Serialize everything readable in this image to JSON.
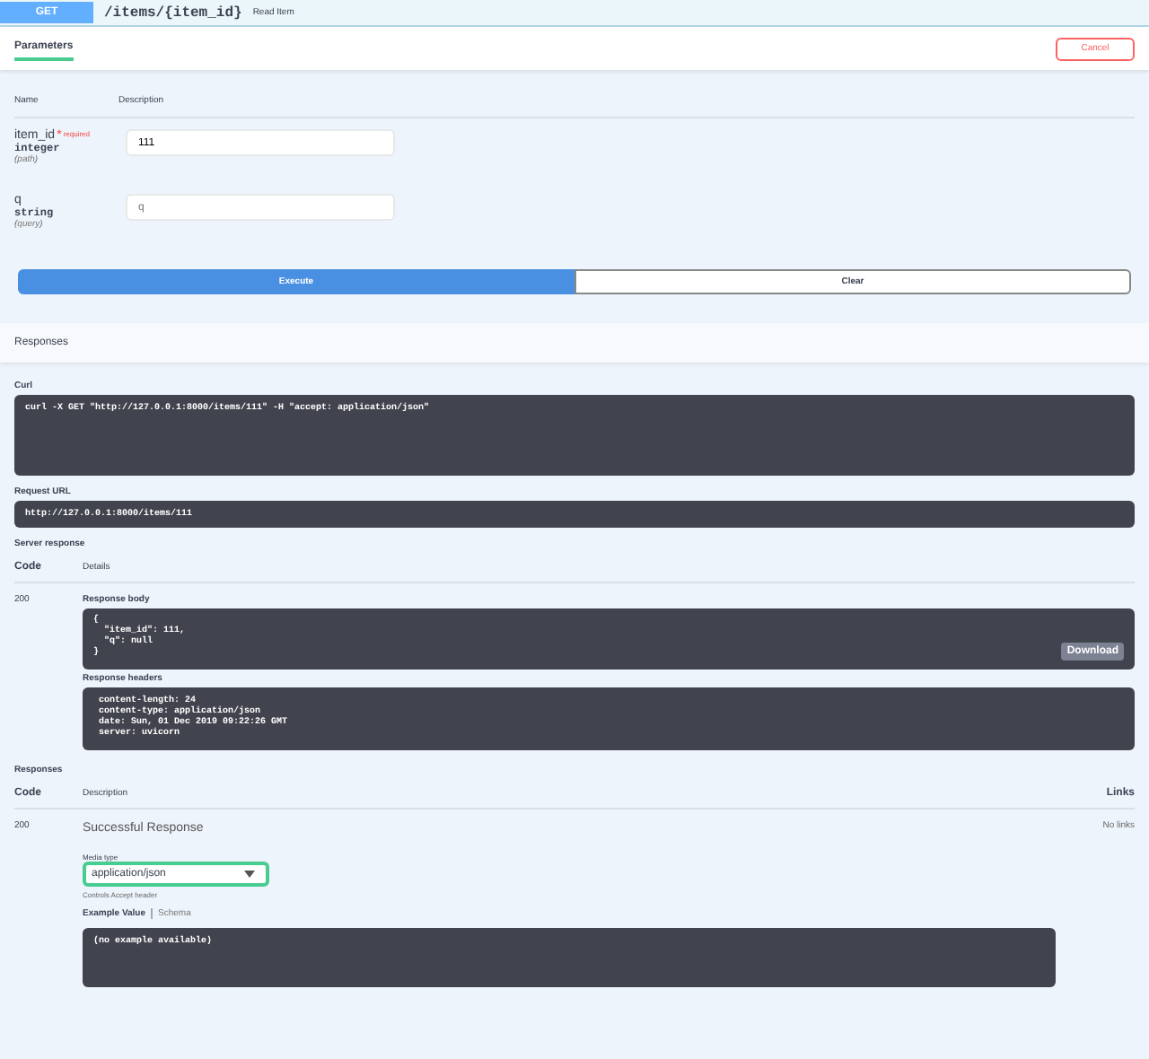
{
  "operation": {
    "method": "GET",
    "path": "/items/{item_id}",
    "summary": "Read Item"
  },
  "parameters_bar": {
    "label": "Parameters",
    "cancel_button": "Cancel"
  },
  "param_columns": [
    "Name",
    "Description"
  ],
  "parameters": [
    {
      "name": "item_id",
      "required_mark": "*",
      "required_label": "required",
      "type": "integer",
      "location": "(path)",
      "value": "111"
    },
    {
      "name": "q",
      "type": "string",
      "location": "(query)",
      "placeholder": "q"
    }
  ],
  "actions": [
    {
      "label": "Execute",
      "kind": "primary"
    },
    {
      "label": "Clear",
      "kind": "secondary"
    }
  ],
  "responses_heading": "Responses",
  "curl": {
    "label": "Curl",
    "command": "curl -X GET \"http://127.0.0.1:8000/items/111\" -H \"accept: application/json\""
  },
  "request_url": {
    "label": "Request URL",
    "url": "http://127.0.0.1:8000/items/111"
  },
  "server_response": {
    "label": "Server response",
    "columns": [
      "Code",
      "Details"
    ],
    "code": "200",
    "body_label": "Response body",
    "body_lines": [
      "{",
      "  \"item_id\": 111,",
      "  \"q\": null",
      "}"
    ],
    "download_button": "Download",
    "headers_label": "Response headers",
    "header_lines": [
      " content-length: 24",
      " content-type: application/json",
      " date: Sun, 01 Dec 2019 09:22:26 GMT",
      " server: uvicorn"
    ]
  },
  "responses": {
    "label": "Responses",
    "columns": [
      "Code",
      "Description",
      "Links"
    ],
    "rows": [
      {
        "code": "200",
        "description": "Successful Response",
        "media_type_label": "Media type",
        "media_type": "application/json",
        "media_hint": "Controls Accept header",
        "example_tabs": [
          {
            "label": "Example Value",
            "selected": true
          },
          {
            "label": "Schema",
            "selected": false
          }
        ],
        "example": "(no example available)",
        "links": "No links"
      }
    ]
  }
}
